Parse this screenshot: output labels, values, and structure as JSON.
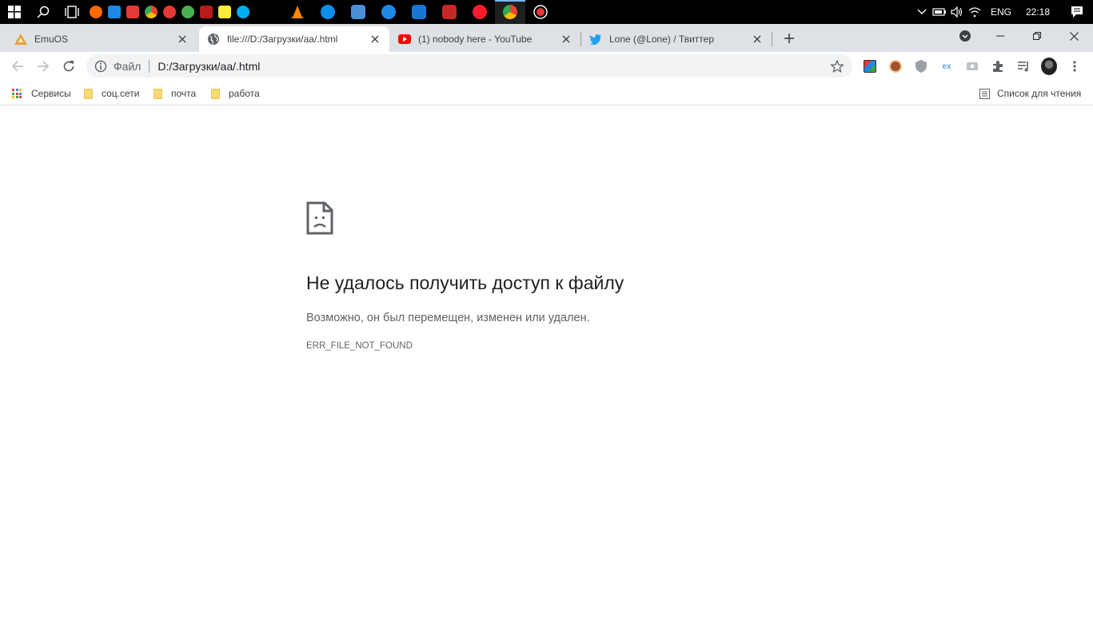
{
  "taskbar": {
    "apps": [
      {
        "icon": "search-icon"
      },
      {
        "icon": "task-view-icon"
      }
    ],
    "pinned_colors": [
      "#ff6a00",
      "#1e88e5",
      "#e53935",
      "#fbbc04",
      "#e53935",
      "#4caf50",
      "#b71c1c",
      "#ffeb3b",
      "#00aff0"
    ],
    "pinned_apps": [
      {
        "icon": "vlc-icon",
        "color": "#ff8800"
      },
      {
        "icon": "teamviewer-icon",
        "color": "#0e8ee9"
      },
      {
        "icon": "remote-desktop-icon",
        "color": "#4a90d9"
      },
      {
        "icon": "quick-assist-icon",
        "color": "#1e88e5"
      },
      {
        "icon": "maps-icon",
        "color": "#1976d2"
      },
      {
        "icon": "download-manager-icon",
        "color": "#c62828"
      },
      {
        "icon": "opera-icon",
        "color": "#ff1b2d"
      },
      {
        "icon": "chrome-icon",
        "color": "#4285f4"
      },
      {
        "icon": "recorder-icon",
        "color": "#e53935"
      }
    ],
    "tray": {
      "language": "ENG",
      "time": "22:18"
    }
  },
  "tabs": [
    {
      "title": "EmuOS",
      "icon": "emuos-favicon"
    },
    {
      "title": "file:///D:/Загрузки/aa/.html",
      "icon": "globe-icon"
    },
    {
      "title": "(1) nobody here - YouTube",
      "icon": "youtube-icon"
    },
    {
      "title": "Lone (@Lone) / Твиттер",
      "icon": "twitter-icon"
    }
  ],
  "toolbar": {
    "chip": "Файл",
    "url": "D:/Загрузки/aa/.html"
  },
  "bookmarks": {
    "apps_label": "Сервисы",
    "items": [
      "соц.сети",
      "почта",
      "работа"
    ],
    "reading_list": "Список для чтения"
  },
  "error": {
    "title": "Не удалось получить доступ к файлу",
    "description": "Возможно, он был перемещен, изменен или удален.",
    "code": "ERR_FILE_NOT_FOUND"
  },
  "colors": {
    "accent_blue": "#1a73e8",
    "tab_strip": "#dee1e6",
    "folder": "#f8d775"
  }
}
